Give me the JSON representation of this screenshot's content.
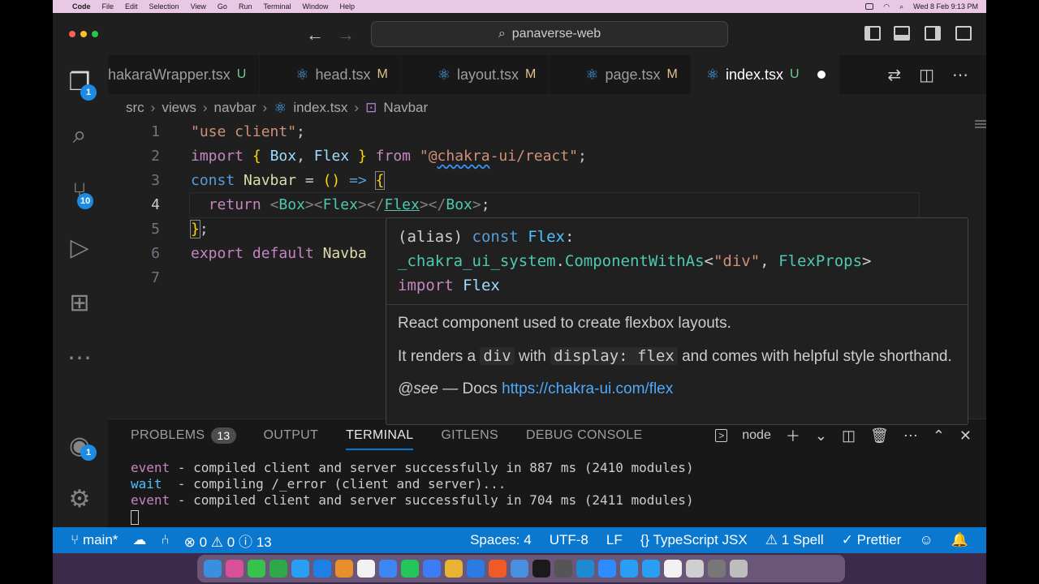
{
  "menubar": {
    "app": "Code",
    "items": [
      "File",
      "Edit",
      "Selection",
      "View",
      "Go",
      "Run",
      "Terminal",
      "Window",
      "Help"
    ],
    "clock": "Wed 8 Feb  9:13 PM"
  },
  "titlebar": {
    "search_text": "panaverse-web"
  },
  "activity": {
    "explorer_badge": "1",
    "scm_badge": "10",
    "accounts_badge": "1"
  },
  "tabs": [
    {
      "label": "hakaraWrapper.tsx",
      "status": "U"
    },
    {
      "label": "head.tsx",
      "status": "M"
    },
    {
      "label": "layout.tsx",
      "status": "M"
    },
    {
      "label": "page.tsx",
      "status": "M"
    },
    {
      "label": "index.tsx",
      "status": "U"
    }
  ],
  "breadcrumb": [
    "src",
    "views",
    "navbar",
    "index.tsx",
    "Navbar"
  ],
  "editor": {
    "line_numbers": [
      "1",
      "2",
      "3",
      "4",
      "5",
      "6",
      "7"
    ],
    "l1": "\"use client\"",
    "l2_import": "import",
    "l2_box": "Box",
    "l2_flex": "Flex",
    "l2_from": "from",
    "l2_mod_a": "\"@",
    "l2_mod_b": "chakra",
    "l2_mod_c": "-ui/react\"",
    "l3_const": "const",
    "l3_name": "Navbar",
    "l4_return": "return",
    "l4_box": "Box",
    "l4_flex": "Flex",
    "l6_export": "export default",
    "l6_name": "Navba"
  },
  "hover": {
    "sig_alias": "(alias)",
    "sig_const": "const",
    "sig_flex": "Flex",
    "sig_ns": "_chakra_ui_system",
    "sig_type": "ComponentWithAs",
    "sig_div": "\"div\"",
    "sig_props": "FlexProps",
    "sig_import": "import",
    "sig_import_name": "Flex",
    "desc": "React component used to create flexbox layouts.",
    "renders_a": "It renders a",
    "renders_div": "div",
    "renders_with": "with",
    "renders_display": "display: flex",
    "renders_rest": "and comes with helpful style shorthand.",
    "see_tag": "@see",
    "see_dash": "— Docs",
    "see_link": "https://chakra-ui.com/flex"
  },
  "panel": {
    "tabs": [
      "PROBLEMS",
      "OUTPUT",
      "TERMINAL",
      "GITLENS",
      "DEBUG CONSOLE"
    ],
    "problems_count": "13",
    "terminal_name": "node",
    "lines": [
      {
        "tag": "event",
        "text": " - compiled client and server successfully in 887 ms (2410 modules)"
      },
      {
        "tag": "wait",
        "text": "  - compiling /_error (client and server)..."
      },
      {
        "tag": "event",
        "text": " - compiled client and server successfully in 704 ms (2411 modules)"
      }
    ]
  },
  "statusbar": {
    "branch": "main*",
    "errors": "0",
    "warnings": "0",
    "info": "13",
    "spaces": "Spaces: 4",
    "encoding": "UTF-8",
    "eol": "LF",
    "language": "TypeScript JSX",
    "spell": "1 Spell",
    "prettier": "Prettier"
  },
  "colors": {
    "accent": "#0b78d0",
    "editor_bg": "#1f1f1f",
    "menubar": "#e9c8e6"
  }
}
